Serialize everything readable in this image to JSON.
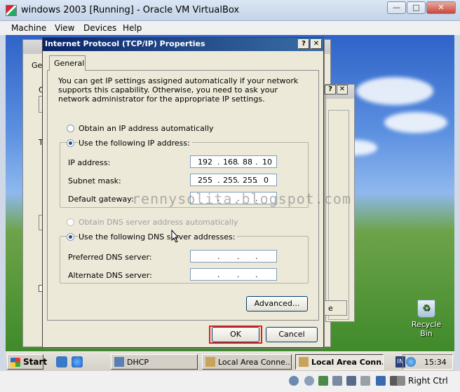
{
  "host": {
    "title": "windows 2003 [Running] - Oracle VM VirtualBox",
    "window_buttons": [
      "—",
      "□",
      "✕"
    ],
    "menu": [
      "Machine",
      "View",
      "Devices",
      "Help"
    ],
    "host_key_label": "Right Ctrl"
  },
  "dialog": {
    "title": "Internet Protocol (TCP/IP) Properties",
    "help_button": "?",
    "close_button": "✕",
    "tab": "General",
    "description": "You can get IP settings assigned automatically if your network supports this capability. Otherwise, you need to ask your network administrator for the appropriate IP settings.",
    "ip_auto_label": "Obtain an IP address automatically",
    "ip_manual_label": "Use the following IP address:",
    "ip_mode": "manual",
    "ip_address_label": "IP address:",
    "subnet_mask_label": "Subnet mask:",
    "default_gateway_label": "Default gateway:",
    "ip_address": [
      "192",
      "168",
      "88",
      "10"
    ],
    "subnet_mask": [
      "255",
      "255",
      "255",
      "0"
    ],
    "default_gateway": [
      "",
      "",
      "",
      ""
    ],
    "dns_auto_label": "Obtain DNS server address automatically",
    "dns_manual_label": "Use the following DNS server addresses:",
    "dns_mode": "manual",
    "preferred_dns_label": "Preferred DNS server:",
    "alternate_dns_label": "Alternate DNS server:",
    "preferred_dns": [
      "",
      "",
      "",
      ""
    ],
    "alternate_dns": [
      "",
      "",
      "",
      ""
    ],
    "advanced_button": "Advanced...",
    "ok_button": "OK",
    "cancel_button": "Cancel"
  },
  "background_window": {
    "fragments": [
      "Ge",
      "C",
      "T",
      "e"
    ]
  },
  "desktop": {
    "recycle_bin_label": "Recycle Bin",
    "watermark": "rennysolita.blogspot.com"
  },
  "taskbar": {
    "start_label": "Start",
    "tasks": [
      {
        "label": "DHCP",
        "active": false
      },
      {
        "label": "Local Area Conne...",
        "active": false
      },
      {
        "label": "Local Area Conn...",
        "active": true
      }
    ],
    "tray_lang": "IN",
    "clock": "15:34"
  },
  "colors": {
    "dialog_face": "#ece9d8",
    "title_active": "#0a246a",
    "ok_highlight": "#e02020"
  }
}
